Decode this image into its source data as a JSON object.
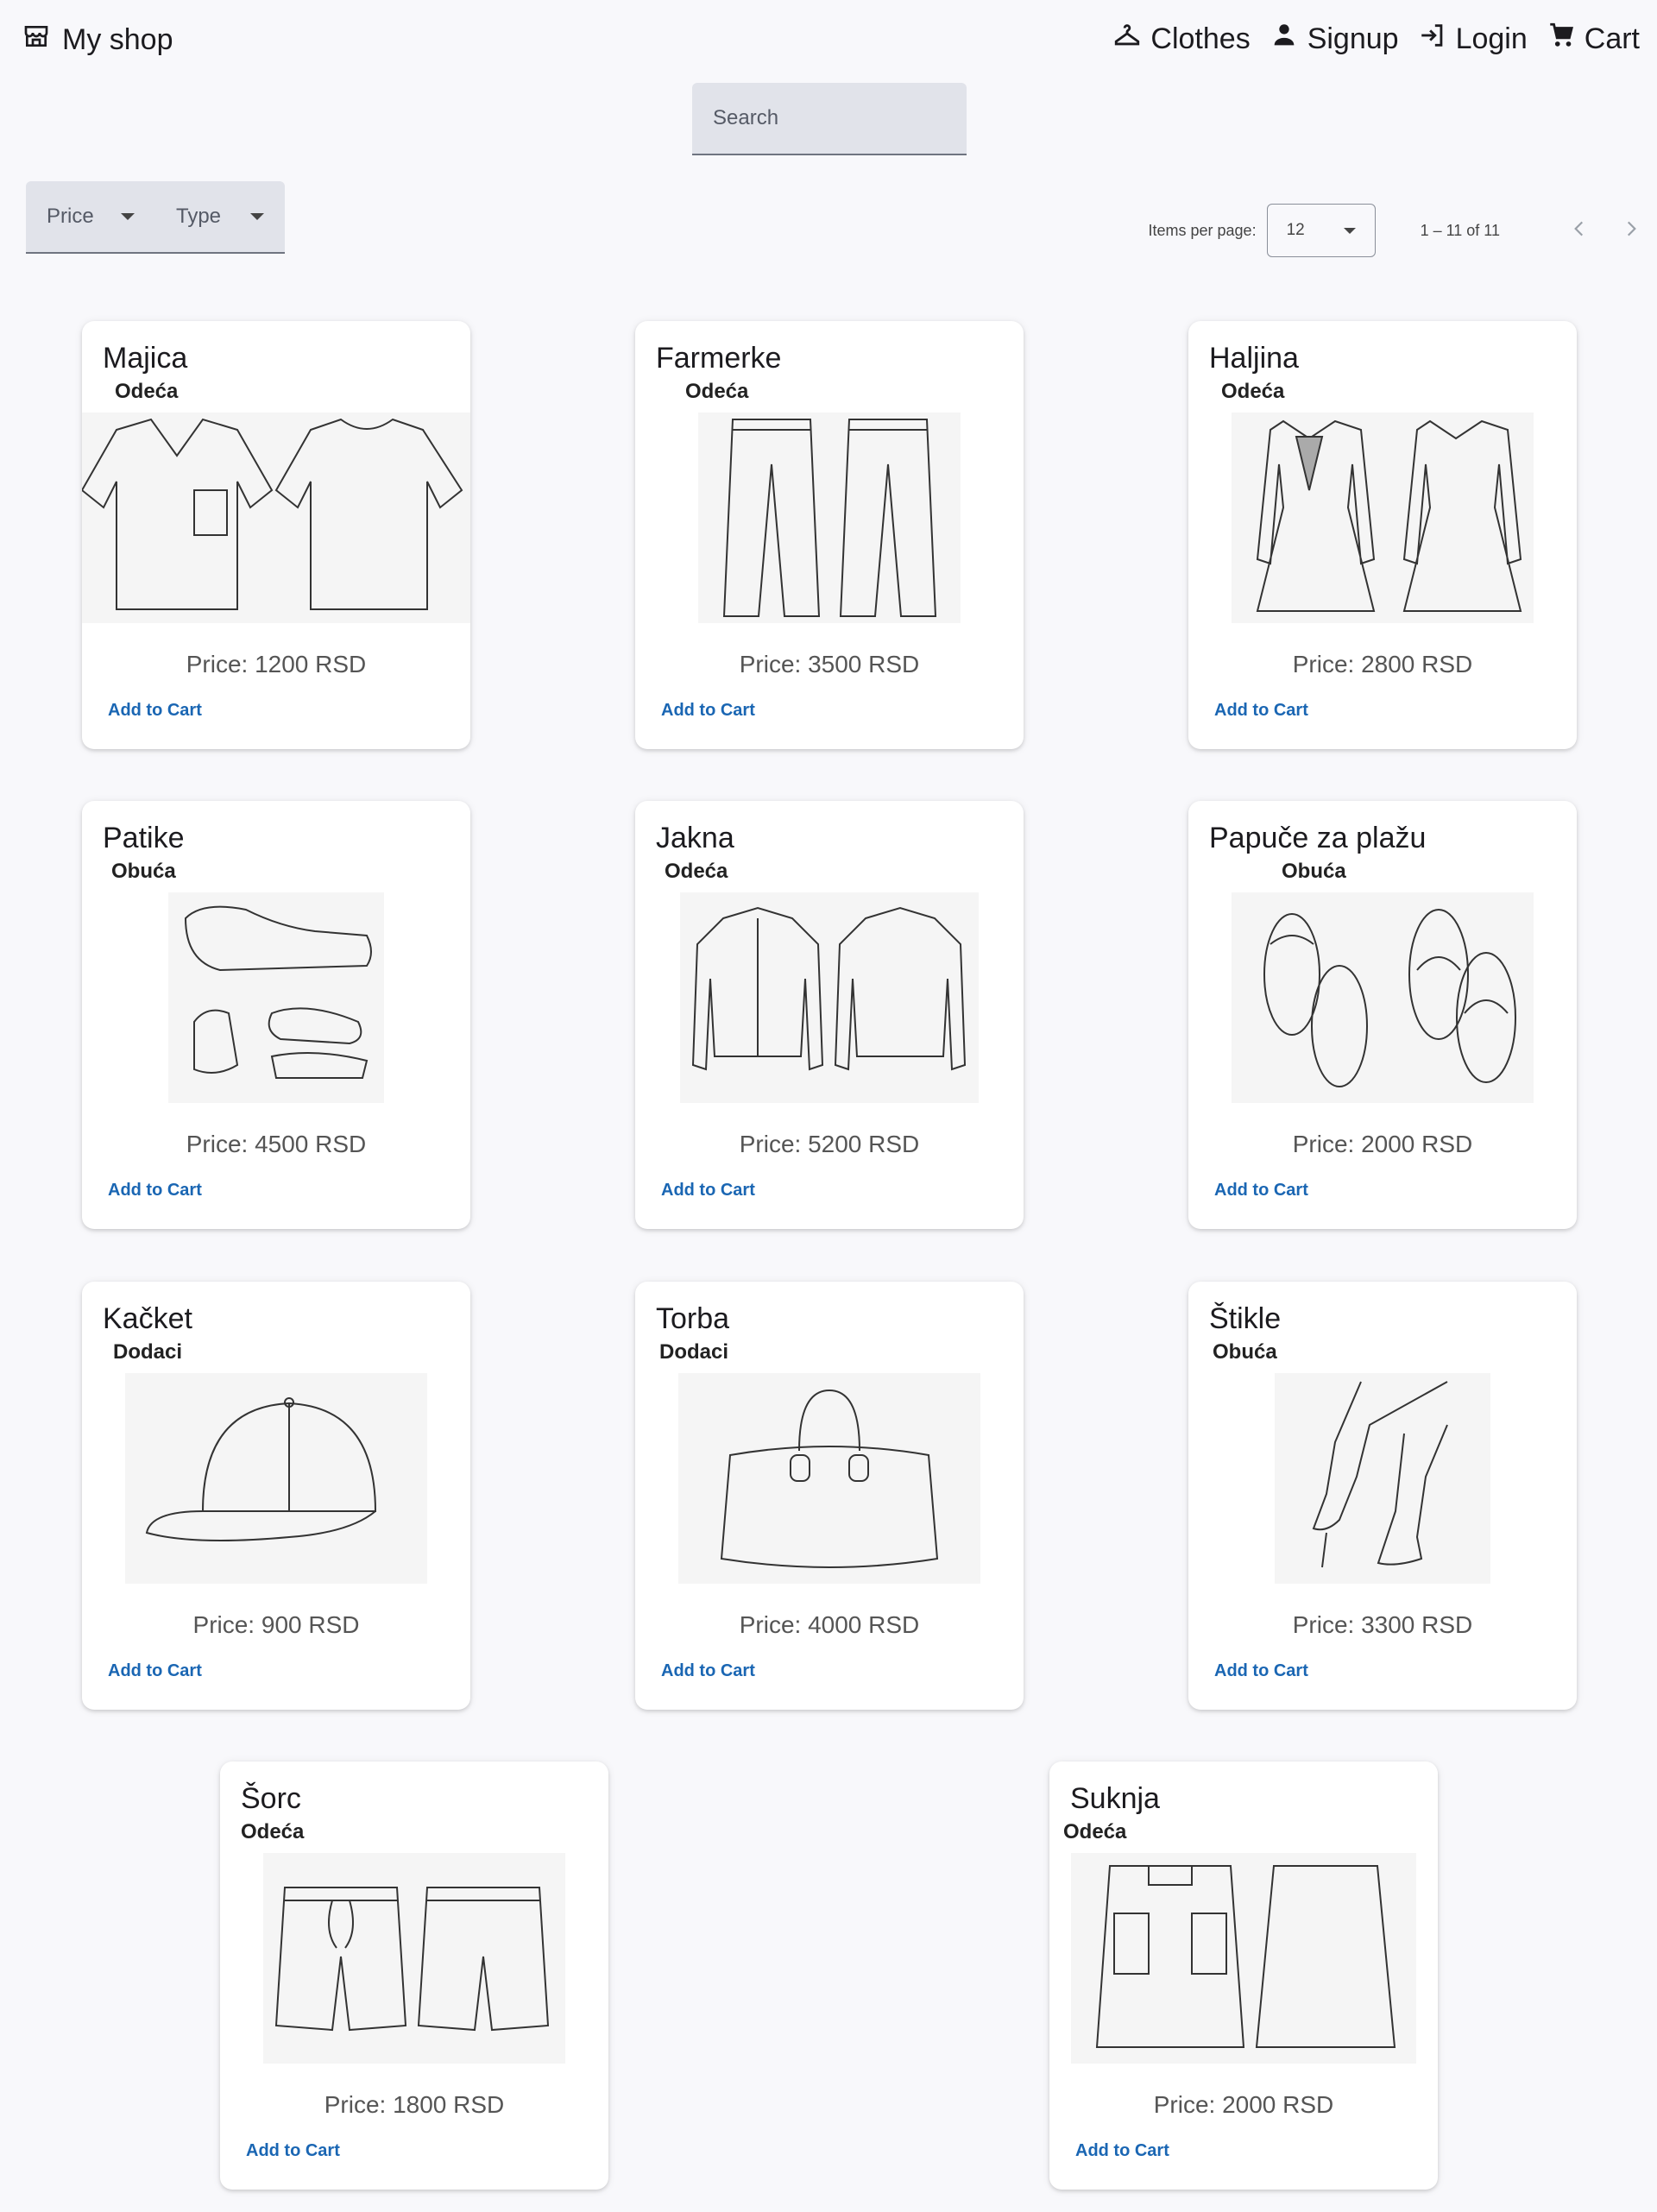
{
  "header": {
    "brand": "My shop",
    "nav": [
      {
        "label": "Clothes",
        "icon": "hanger-icon"
      },
      {
        "label": "Signup",
        "icon": "person-icon"
      },
      {
        "label": "Login",
        "icon": "login-icon"
      },
      {
        "label": "Cart",
        "icon": "cart-icon"
      }
    ]
  },
  "search": {
    "placeholder": "Search"
  },
  "filters": {
    "price": "Price",
    "type": "Type"
  },
  "paginator": {
    "items_per_page_label": "Items per page:",
    "items_per_page": "12",
    "range": "1 – 11 of 11"
  },
  "products": [
    {
      "name": "Majica",
      "category": "Odeća",
      "price": "Price: 1200 RSD",
      "add": "Add to Cart",
      "icon": "tshirt-sketch"
    },
    {
      "name": "Farmerke",
      "category": "Odeća",
      "price": "Price: 3500 RSD",
      "add": "Add to Cart",
      "icon": "jeans-sketch"
    },
    {
      "name": "Haljina",
      "category": "Odeća",
      "price": "Price: 2800 RSD",
      "add": "Add to Cart",
      "icon": "dress-sketch"
    },
    {
      "name": "Patike",
      "category": "Obuća",
      "price": "Price: 4500 RSD",
      "add": "Add to Cart",
      "icon": "sneakers-sketch"
    },
    {
      "name": "Jakna",
      "category": "Odeća",
      "price": "Price: 5200 RSD",
      "add": "Add to Cart",
      "icon": "jacket-sketch"
    },
    {
      "name": "Papuče za plažu",
      "category": "Obuća",
      "price": "Price: 2000 RSD",
      "add": "Add to Cart",
      "icon": "slippers-sketch"
    },
    {
      "name": "Kačket",
      "category": "Dodaci",
      "price": "Price: 900 RSD",
      "add": "Add to Cart",
      "icon": "cap-sketch"
    },
    {
      "name": "Torba",
      "category": "Dodaci",
      "price": "Price: 4000 RSD",
      "add": "Add to Cart",
      "icon": "bag-sketch"
    },
    {
      "name": "Štikle",
      "category": "Obuća",
      "price": "Price: 3300 RSD",
      "add": "Add to Cart",
      "icon": "heels-sketch"
    },
    {
      "name": "Šorc",
      "category": "Odeća",
      "price": "Price: 1800 RSD",
      "add": "Add to Cart",
      "icon": "shorts-sketch"
    },
    {
      "name": "Suknja",
      "category": "Odeća",
      "price": "Price: 2000 RSD",
      "add": "Add to Cart",
      "icon": "skirt-sketch"
    }
  ]
}
